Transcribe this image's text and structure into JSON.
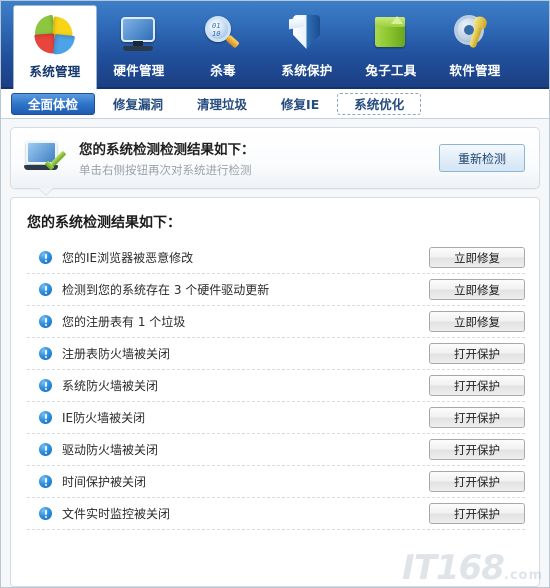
{
  "toolbar": {
    "items": [
      {
        "label": "系统管理",
        "icon": "pie-chart-icon",
        "active": true
      },
      {
        "label": "硬件管理",
        "icon": "monitor-icon",
        "active": false
      },
      {
        "label": "杀毒",
        "icon": "magnifier-icon",
        "active": false
      },
      {
        "label": "系统保护",
        "icon": "shield-icon",
        "active": false
      },
      {
        "label": "兔子工具",
        "icon": "green-box-icon",
        "active": false
      },
      {
        "label": "软件管理",
        "icon": "gear-wrench-icon",
        "active": false
      }
    ]
  },
  "tabs": [
    {
      "label": "全面体检",
      "state": "active"
    },
    {
      "label": "修复漏洞",
      "state": "normal"
    },
    {
      "label": "清理垃圾",
      "state": "normal"
    },
    {
      "label": "修复IE",
      "state": "normal"
    },
    {
      "label": "系统优化",
      "state": "dashed"
    }
  ],
  "banner": {
    "icon": "monitor-check-icon",
    "title": "您的系统检测检测结果如下：",
    "subtitle": "单击右侧按钮再次对系统进行检测",
    "button_label": "重新检测"
  },
  "results": {
    "title": "您的系统检测结果如下：",
    "rows": [
      {
        "icon": "info-exclamation-icon",
        "text": "您的IE浏览器被恶意修改",
        "action": "立即修复"
      },
      {
        "icon": "info-exclamation-icon",
        "text": "检测到您的系统存在 3 个硬件驱动更新",
        "action": "立即修复"
      },
      {
        "icon": "info-exclamation-icon",
        "text": "您的注册表有 1 个垃圾",
        "action": "立即修复"
      },
      {
        "icon": "info-exclamation-icon",
        "text": "注册表防火墙被关闭",
        "action": "打开保护"
      },
      {
        "icon": "info-exclamation-icon",
        "text": "系统防火墙被关闭",
        "action": "打开保护"
      },
      {
        "icon": "info-exclamation-icon",
        "text": "IE防火墙被关闭",
        "action": "打开保护"
      },
      {
        "icon": "info-exclamation-icon",
        "text": "驱动防火墙被关闭",
        "action": "打开保护"
      },
      {
        "icon": "info-exclamation-icon",
        "text": "时间保护被关闭",
        "action": "打开保护"
      },
      {
        "icon": "info-exclamation-icon",
        "text": "文件实时监控被关闭",
        "action": "打开保护"
      }
    ]
  },
  "watermark": {
    "brand": "IT168",
    "domain": ".com"
  },
  "colors": {
    "header_top": "#3d7fc9",
    "header_bottom": "#1b3f83",
    "tab_active": "#2f74c8",
    "info_icon": "#2d8fe0",
    "panel_bg": "#ffffff",
    "content_bg": "#f5f7f9"
  }
}
